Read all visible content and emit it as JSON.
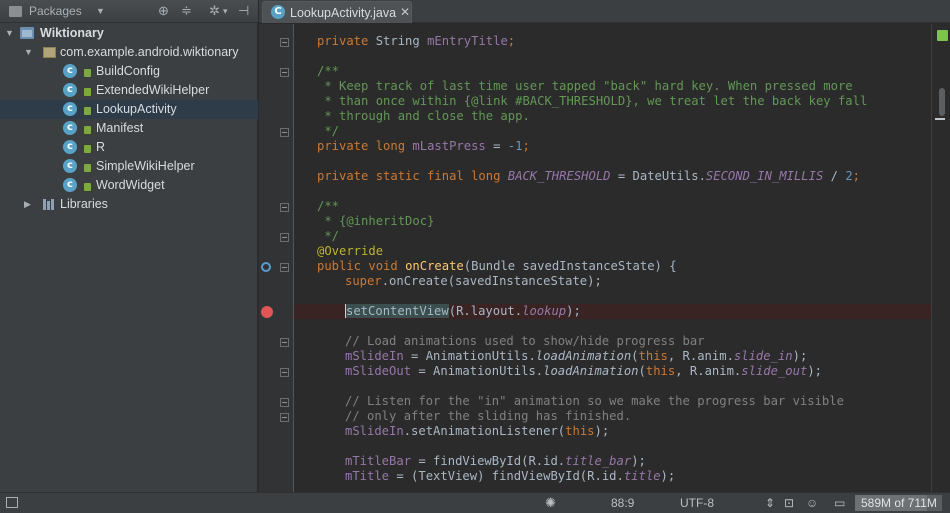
{
  "left_panel": {
    "view_label": "Packages",
    "tree": [
      {
        "label": "Wiktionary"
      },
      {
        "label": "com.example.android.wiktionary"
      },
      {
        "label": "BuildConfig"
      },
      {
        "label": "ExtendedWikiHelper"
      },
      {
        "label": "LookupActivity"
      },
      {
        "label": "Manifest"
      },
      {
        "label": "R"
      },
      {
        "label": "SimpleWikiHelper"
      },
      {
        "label": "WordWidget"
      },
      {
        "label": "Libraries"
      }
    ],
    "class_letter": "c"
  },
  "editor": {
    "tab": {
      "label": "LookupActivity.java",
      "icon_letter": "C"
    },
    "lines": {
      "l1": {
        "a": "private ",
        "b": "String ",
        "c": "mEntryTitle",
        "d": ";"
      },
      "c1": "/**",
      "c2": " * Keep track of last time user tapped \"back\" hard key. When pressed more",
      "c3": " * than once within {@link #BACK_THRESHOLD}, we treat let the back key fall",
      "c4": " * through and close the app.",
      "c5": " */",
      "l2": {
        "a": "private long ",
        "b": "mLastPress",
        "c": " = ",
        "d": "-1",
        "e": ";"
      },
      "l3": {
        "a": "private static final long ",
        "b": "BACK_THRESHOLD",
        "c": " = DateUtils.",
        "d": "SECOND_IN_MILLIS",
        "e": " / ",
        "f": "2",
        "g": ";"
      },
      "c6": "/**",
      "c7": " * {@inheritDoc}",
      "c8": " */",
      "l4": "@Override",
      "l5": {
        "a": "public void ",
        "b": "onCreate",
        "c": "(Bundle savedInstanceState) {"
      },
      "l6": {
        "a": "super",
        "b": ".onCreate(savedInstanceState);"
      },
      "l7": {
        "a": "s",
        "b": "etContentView",
        "c": "(R.layout.",
        "d": "lookup",
        "e": ");"
      },
      "l8": "// Load animations used to show/hide progress bar",
      "l9": {
        "a": "mSlideIn",
        "b": " = AnimationUtils.",
        "c": "loadAnimation",
        "d": "(",
        "e": "this",
        "f": ", R.anim.",
        "g": "slide_in",
        "h": ");"
      },
      "l10": {
        "a": "mSlideOut",
        "b": " = AnimationUtils.",
        "c": "loadAnimation",
        "d": "(",
        "e": "this",
        "f": ", R.anim.",
        "g": "slide_out",
        "h": ");"
      },
      "l11": "// Listen for the \"in\" animation so we make the progress bar visible",
      "l12": "// only after the sliding has finished.",
      "l13": {
        "a": "mSlideIn",
        "b": ".setAnimationListener(",
        "c": "this",
        "d": ");"
      },
      "l14": {
        "a": "mTitleBar",
        "b": " = findViewById(R.id.",
        "c": "title_bar",
        "d": ");"
      },
      "l15": {
        "a": "mTitle",
        "b": " = (TextView) findViewById(R.id.",
        "c": "title",
        "d": ");"
      }
    }
  },
  "status_bar": {
    "position": "88:9",
    "encoding": "UTF-8",
    "encoding_arrows": "⇕",
    "memory": "589M of 711M",
    "memory_fraction": 0.828
  }
}
